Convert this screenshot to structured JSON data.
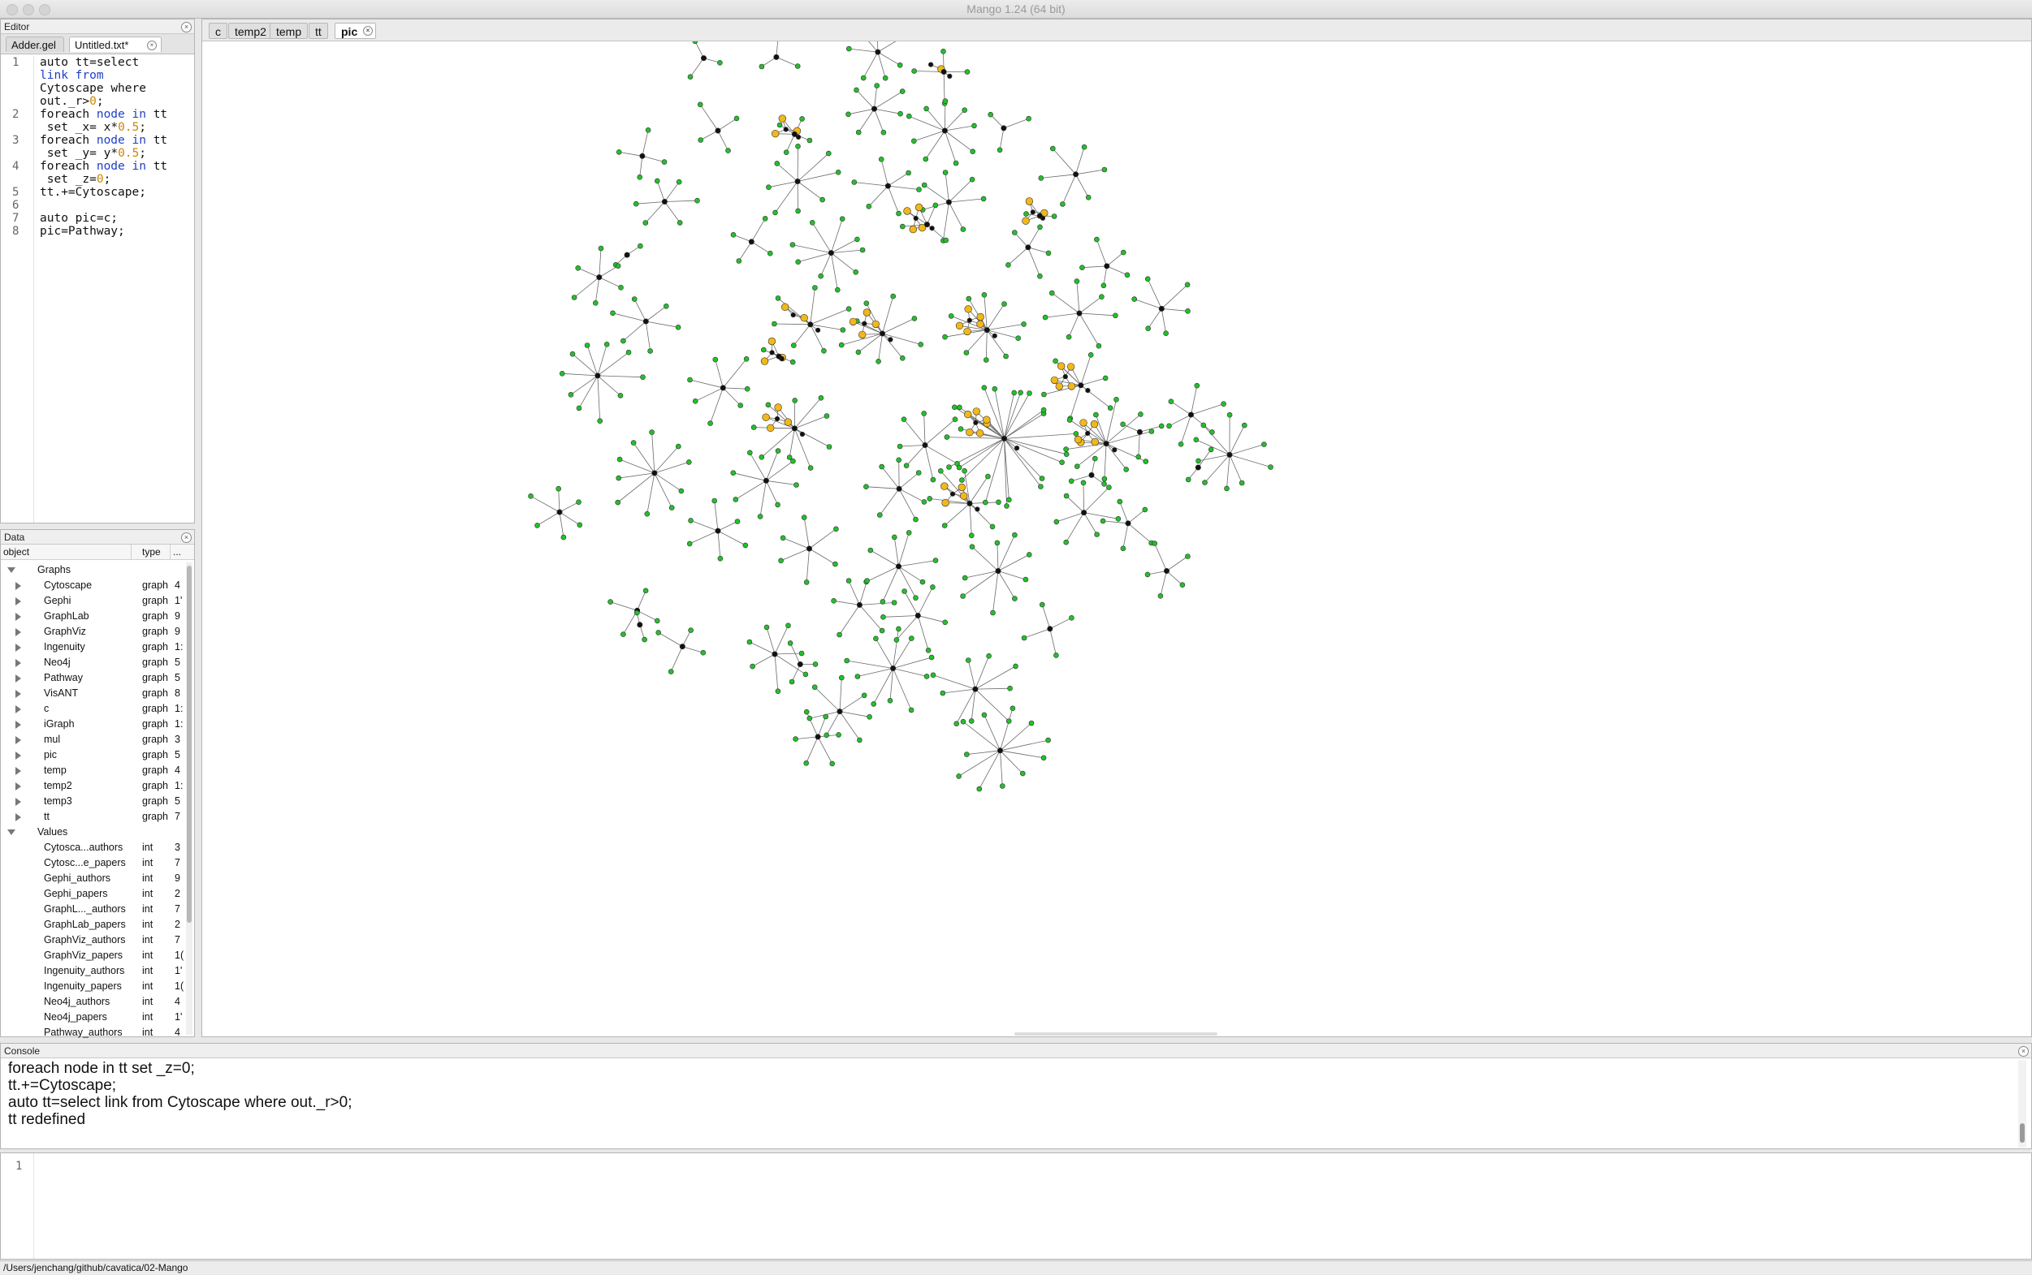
{
  "window": {
    "title": "Mango 1.24 (64 bit)"
  },
  "editor": {
    "panel_title": "Editor",
    "tabs": [
      {
        "label": "Adder.gel",
        "active": false
      },
      {
        "label": "Untitled.txt*",
        "active": true
      }
    ],
    "line_numbers": [
      "1",
      "2",
      "3",
      "4",
      "5",
      "6",
      "7",
      "8"
    ],
    "lines": [
      {
        "num": "1",
        "text": "auto tt=select"
      },
      {
        "num": "",
        "text": "link from"
      },
      {
        "num": "",
        "text": "Cytoscape where"
      },
      {
        "num": "",
        "text": "out._r>0;"
      },
      {
        "num": "2",
        "text": "foreach node in tt"
      },
      {
        "num": "",
        "text": " set _x= x*0.5;"
      },
      {
        "num": "3",
        "text": "foreach node in tt"
      },
      {
        "num": "",
        "text": " set _y= y*0.5;"
      },
      {
        "num": "4",
        "text": "foreach node in tt"
      },
      {
        "num": "",
        "text": " set _z=0;"
      },
      {
        "num": "5",
        "text": "tt.+=Cytoscape;"
      },
      {
        "num": "6",
        "text": ""
      },
      {
        "num": "7",
        "text": "auto pic=c;"
      },
      {
        "num": "8",
        "text": "pic=Pathway;"
      }
    ]
  },
  "data_panel": {
    "panel_title": "Data",
    "columns": {
      "object": "object",
      "type": "type",
      "more": "..."
    },
    "groups": [
      {
        "name": "Graphs",
        "items": [
          {
            "name": "Cytoscape",
            "type": "graph",
            "value": "4"
          },
          {
            "name": "Gephi",
            "type": "graph",
            "value": "1'"
          },
          {
            "name": "GraphLab",
            "type": "graph",
            "value": "9"
          },
          {
            "name": "GraphViz",
            "type": "graph",
            "value": "9"
          },
          {
            "name": "Ingenuity",
            "type": "graph",
            "value": "1:"
          },
          {
            "name": "Neo4j",
            "type": "graph",
            "value": "5"
          },
          {
            "name": "Pathway",
            "type": "graph",
            "value": "5"
          },
          {
            "name": "VisANT",
            "type": "graph",
            "value": "8"
          },
          {
            "name": "c",
            "type": "graph",
            "value": "1:"
          },
          {
            "name": "iGraph",
            "type": "graph",
            "value": "1:"
          },
          {
            "name": "mul",
            "type": "graph",
            "value": "3"
          },
          {
            "name": "pic",
            "type": "graph",
            "value": "5"
          },
          {
            "name": "temp",
            "type": "graph",
            "value": "4"
          },
          {
            "name": "temp2",
            "type": "graph",
            "value": "1:"
          },
          {
            "name": "temp3",
            "type": "graph",
            "value": "5"
          },
          {
            "name": "tt",
            "type": "graph",
            "value": "7"
          }
        ]
      },
      {
        "name": "Values",
        "items": [
          {
            "name": "Cytosca...authors",
            "type": "int",
            "value": "3"
          },
          {
            "name": "Cytosc...e_papers",
            "type": "int",
            "value": "7"
          },
          {
            "name": "Gephi_authors",
            "type": "int",
            "value": "9"
          },
          {
            "name": "Gephi_papers",
            "type": "int",
            "value": "2"
          },
          {
            "name": "GraphL..._authors",
            "type": "int",
            "value": "7"
          },
          {
            "name": "GraphLab_papers",
            "type": "int",
            "value": "2"
          },
          {
            "name": "GraphViz_authors",
            "type": "int",
            "value": "7"
          },
          {
            "name": "GraphViz_papers",
            "type": "int",
            "value": "1("
          },
          {
            "name": "Ingenuity_authors",
            "type": "int",
            "value": "1'"
          },
          {
            "name": "Ingenuity_papers",
            "type": "int",
            "value": "1("
          },
          {
            "name": "Neo4j_authors",
            "type": "int",
            "value": "4"
          },
          {
            "name": "Neo4j_papers",
            "type": "int",
            "value": "1'"
          },
          {
            "name": "Pathway_authors",
            "type": "int",
            "value": "4"
          }
        ]
      }
    ]
  },
  "canvas": {
    "tabs": [
      {
        "label": "c",
        "active": false
      },
      {
        "label": "temp2",
        "active": false
      },
      {
        "label": "temp",
        "active": false
      },
      {
        "label": "tt",
        "active": false
      },
      {
        "label": "pic",
        "active": true
      }
    ],
    "colors": {
      "leaf": "#22c02a",
      "hub": "#111111",
      "highlight": "#f2b81a",
      "edge": "#6a6a6a"
    }
  },
  "console": {
    "panel_title": "Console",
    "lines": [
      "foreach node in tt set _z=0;",
      "tt.+=Cytoscape;",
      "auto tt=select link from Cytoscape where out._r>0;",
      "tt redefined"
    ]
  },
  "input": {
    "line_number": "1",
    "value": ""
  },
  "status_bar": {
    "path": "/Users/jenchang/github/cavatica/02-Mango"
  }
}
